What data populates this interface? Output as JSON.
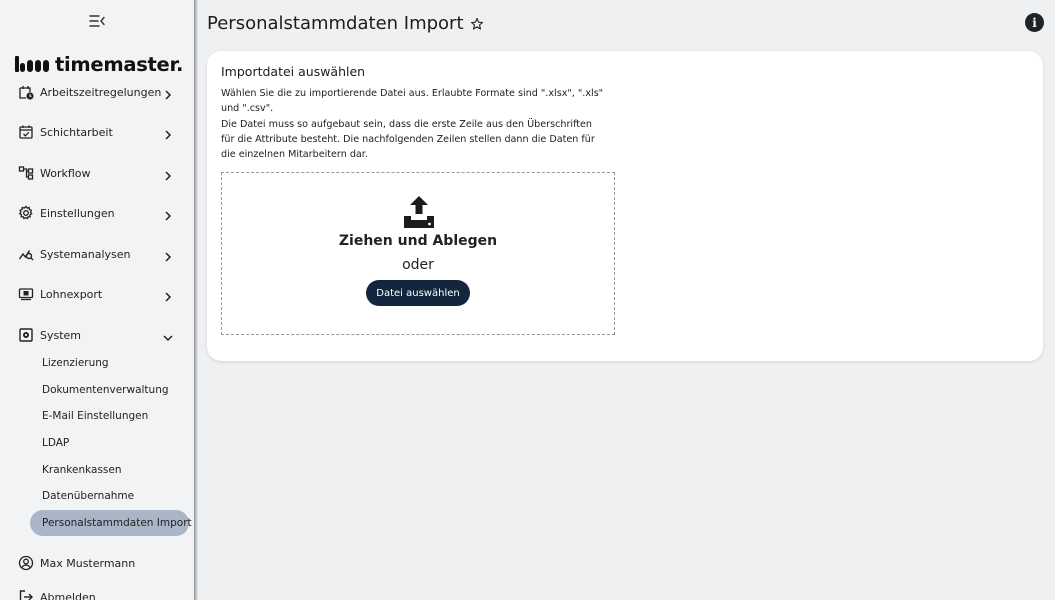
{
  "header": {
    "title": "Personalstammdaten Import",
    "favorite_icon": "star-outline-icon",
    "info_icon": "info-icon"
  },
  "sidebar": {
    "logo_text": "timemaster.",
    "items": [
      {
        "label": "Arbeitszeitregelungen",
        "icon": "calendar-clock-icon",
        "expanded": false
      },
      {
        "label": "Schichtarbeit",
        "icon": "calendar-check-icon",
        "expanded": false
      },
      {
        "label": "Workflow",
        "icon": "workflow-icon",
        "expanded": false
      },
      {
        "label": "Einstellungen",
        "icon": "gear-icon",
        "expanded": false
      },
      {
        "label": "Systemanalysen",
        "icon": "analytics-icon",
        "expanded": false
      },
      {
        "label": "Lohnexport",
        "icon": "payment-icon",
        "expanded": false
      },
      {
        "label": "System",
        "icon": "system-icon",
        "expanded": true
      }
    ],
    "system_subitems": [
      {
        "label": "Lizenzierung"
      },
      {
        "label": "Dokumentenverwaltung"
      },
      {
        "label": "E-Mail Einstellungen"
      },
      {
        "label": "LDAP"
      },
      {
        "label": "Krankenkassen"
      },
      {
        "label": "Datenübernahme"
      },
      {
        "label": "Personalstammdaten Import",
        "active": true
      }
    ],
    "user": {
      "label": "Max Mustermann",
      "icon": "user-circle-icon"
    },
    "logout": {
      "label": "Abmelden",
      "icon": "logout-icon"
    }
  },
  "card": {
    "title": "Importdatei auswählen",
    "desc_line1": "Wählen Sie die zu importierende Datei aus. Erlaubte Formate sind \".xlsx\", \".xls\" und \".csv\".",
    "desc_line2": "Die Datei muss so aufgebaut sein, dass die erste Zeile aus den Überschriften für die Attribute besteht. Die nachfolgenden Zeilen stellen dann die Daten für die einzelnen Mitarbeitern dar.",
    "dropzone": {
      "title": "Ziehen und Ablegen",
      "or": "oder",
      "button": "Datei auswählen"
    }
  },
  "colors": {
    "accent": "#14263e",
    "active_item": "#a9b6c7",
    "background": "#eff0f2"
  }
}
